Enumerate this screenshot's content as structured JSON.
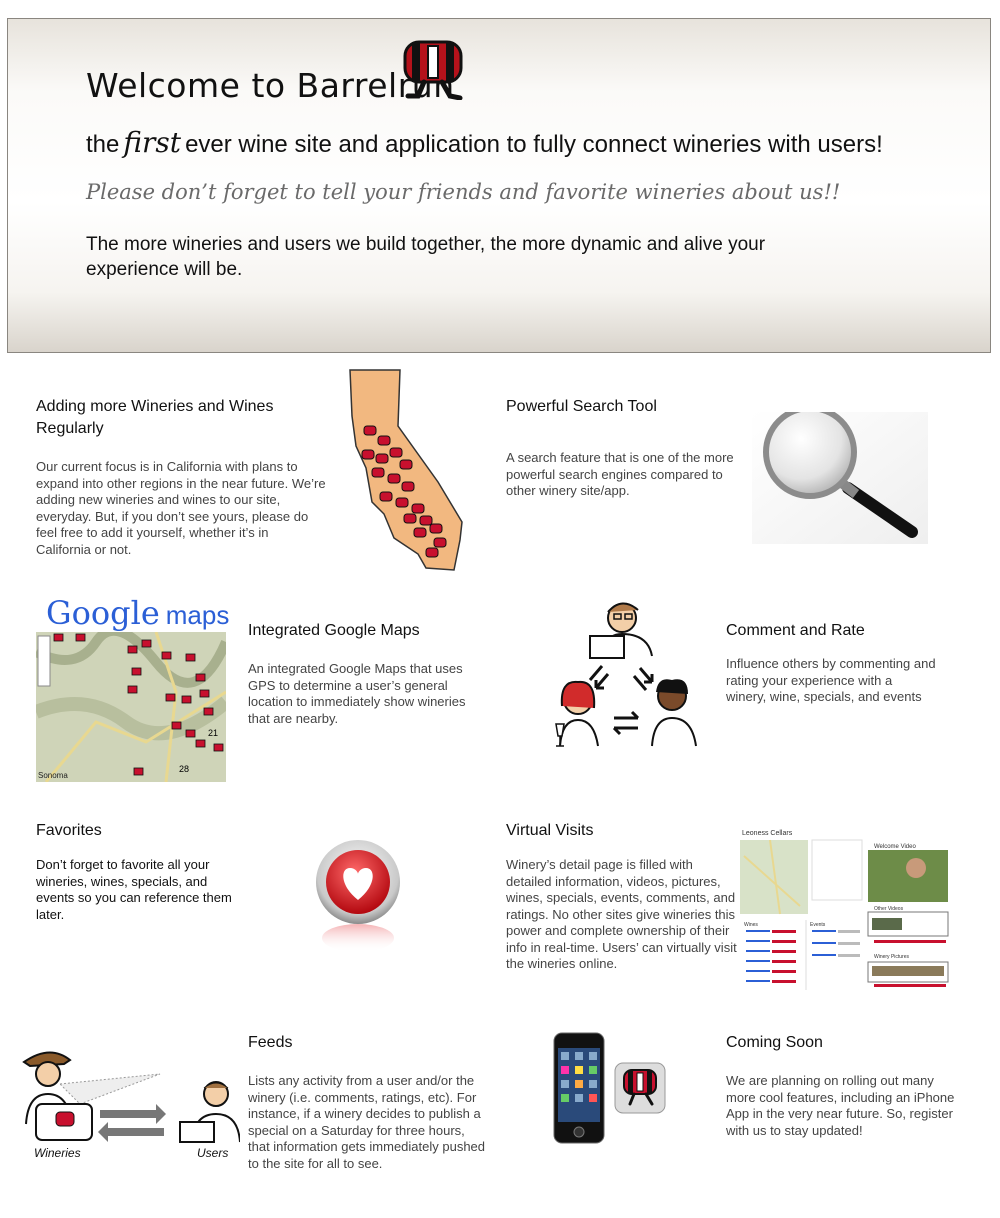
{
  "banner": {
    "welcome": "Welcome to Barrelrun",
    "first_pre": "the",
    "first_word": "first",
    "first_post": "ever wine site and application to fully connect wineries with users!",
    "please": "Please don’t forget to tell your friends and favorite wineries about us!!",
    "more": "The more wineries and users we build together, the more dynamic and alive your experience will be."
  },
  "features": {
    "adding": {
      "title": "Adding more Wineries and Wines Regularly",
      "text": "Our current focus is in California with plans to expand into other regions in the near future. We’re adding new wineries and wines to our site, everyday.  But, if you don’t see yours, please do feel free to add it yourself, whether it’s in California or not."
    },
    "search": {
      "title": "Powerful Search Tool",
      "text": "A search feature that is one of the more powerful search engines compared to other winery site/app."
    },
    "maps": {
      "title": "Integrated Google Maps",
      "text": "An integrated Google Maps that uses GPS to determine a user’s general location to immediately show wineries that are nearby.",
      "logo_google": "Google",
      "logo_maps": "maps",
      "map_labels": [
        "21",
        "28",
        "Sonoma"
      ]
    },
    "comment": {
      "title": "Comment and Rate",
      "text": "Influence others by commenting and rating your experience with a winery, wine, specials, and events"
    },
    "favorites": {
      "title": "Favorites",
      "text": "Don’t forget to favorite all your wineries, wines, specials, and events so you can reference them later."
    },
    "virtual": {
      "title": "Virtual Visits",
      "text": "Winery’s detail page is filled with detailed information, videos, pictures, wines, specials, events, comments, and ratings.  No other sites give wineries this power and complete ownership of their info in real-time. Users’ can virtually visit the wineries online.",
      "shot_title": "Leoness Cellars",
      "shot_video": "Welcome Video",
      "shot_other": "Other Videos",
      "shot_wines": "Wines",
      "shot_events": "Events",
      "shot_pictures": "Winery Pictures"
    },
    "feeds": {
      "title": "Feeds",
      "text": "Lists any activity from a user and/or the winery (i.e. comments, ratings, etc).  For instance, if a winery decides to publish a special on a Saturday for three hours, that information gets immediately pushed to the site for all to see.",
      "label_wineries": "Wineries",
      "label_users": "Users"
    },
    "coming": {
      "title": "Coming Soon",
      "text": "We are planning on rolling out many more cool features, including an iPhone App in the very near future. So, register with us to stay updated!"
    }
  },
  "colors": {
    "barrel_red": "#c8102e",
    "california": "#f2b880",
    "heart_red": "#e0242a"
  }
}
